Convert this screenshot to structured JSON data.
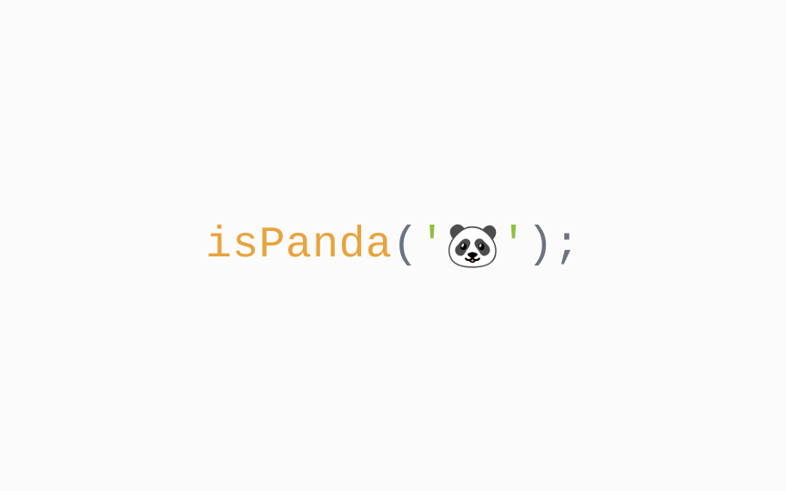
{
  "code": {
    "function_name": "isPanda",
    "open_paren": "(",
    "open_quote": "'",
    "string_content": "🐼",
    "close_quote": "'",
    "close_paren": ")",
    "semicolon": ";"
  },
  "colors": {
    "function": "#e8a33d",
    "punctuation": "#6b7280",
    "string_quote": "#8fbf3f",
    "background": "#fbfbfb"
  }
}
